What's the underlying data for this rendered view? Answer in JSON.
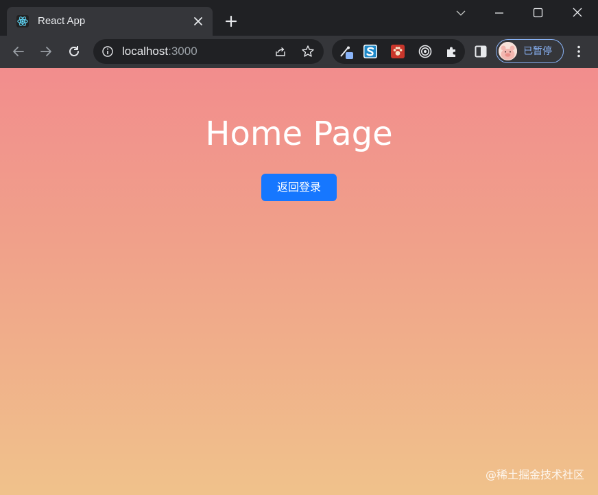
{
  "browser": {
    "tab": {
      "title": "React App",
      "favicon": "react-logo-icon"
    },
    "address_bar": {
      "host": "localhost",
      "port": ":3000"
    },
    "profile": {
      "status_label": "已暂停"
    },
    "colors": {
      "frame": "#202124",
      "toolbar": "#35363a",
      "accent": "#8ab4f8"
    }
  },
  "page": {
    "title": "Home Page",
    "back_button_label": "返回登录",
    "watermark": "@稀土掘金技术社区",
    "colors": {
      "gradient_top": "#f28d8d",
      "gradient_bottom": "#f0c28b",
      "button": "#1677ff"
    }
  }
}
